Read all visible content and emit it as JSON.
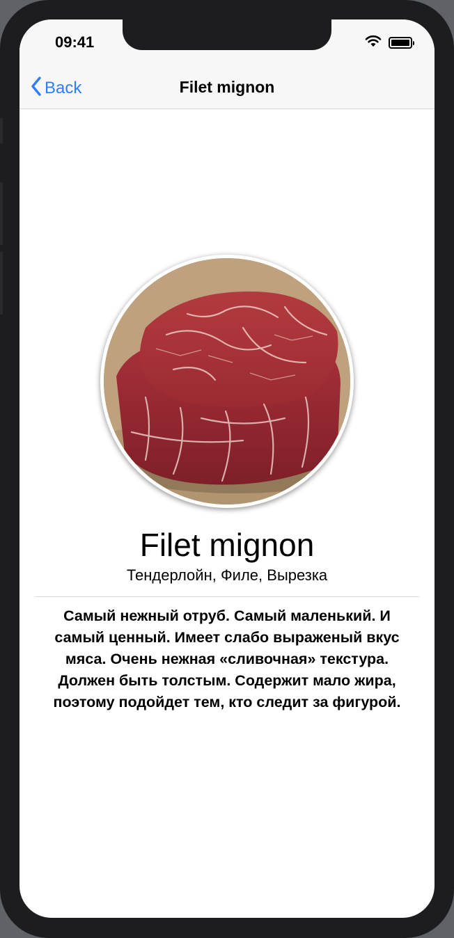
{
  "status_bar": {
    "time": "09:41"
  },
  "nav": {
    "back_label": "Back",
    "title": "Filet mignon"
  },
  "detail": {
    "name": "Filet mignon",
    "synonyms": "Тендерлойн, Филе, Вырезка",
    "description": "Самый нежный отруб. Самый маленький. И самый ценный. Имеет слабо выраженый вкус мяса. Очень нежная «сливочная» текстура. Должен быть толстым. Содержит мало жира, поэтому подойдет тем, кто следит за фигурой.",
    "image_alt": "Filet mignon"
  },
  "colors": {
    "accent": "#2d7ef7",
    "background": "#ffffff",
    "bar": "#f7f7f7"
  }
}
